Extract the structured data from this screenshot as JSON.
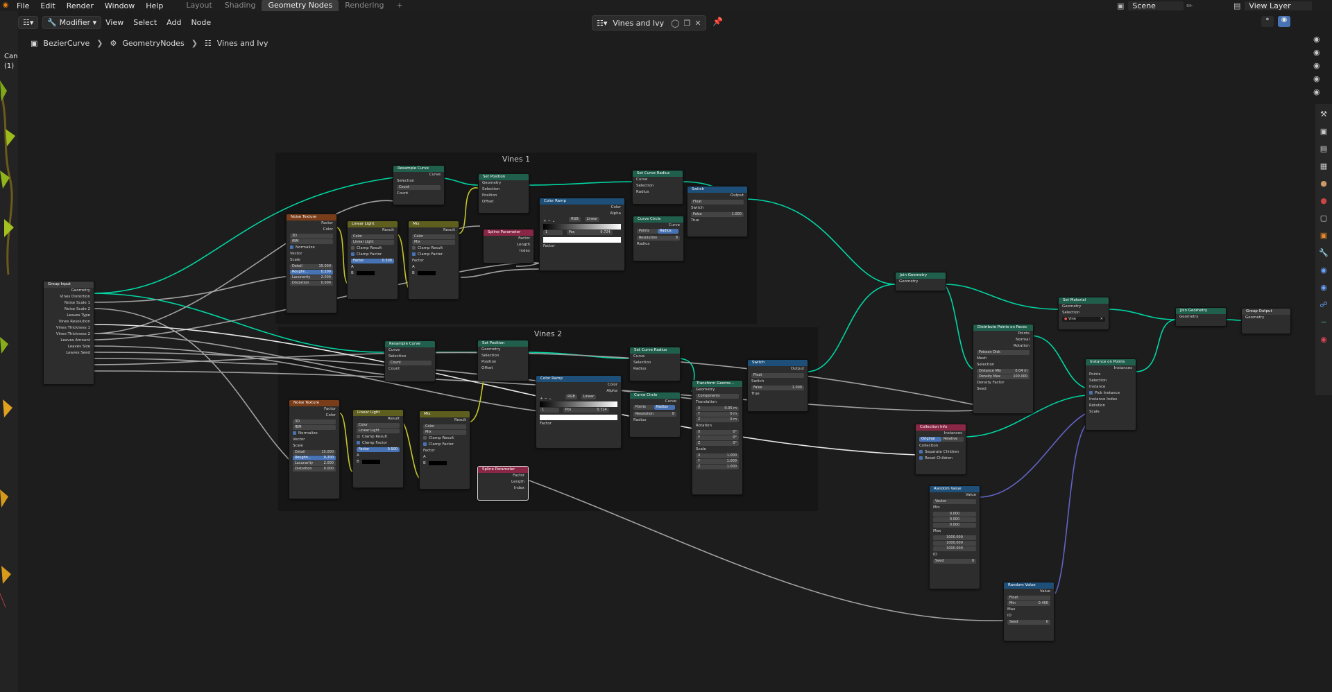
{
  "menubar": {
    "menus": [
      "File",
      "Edit",
      "Render",
      "Window",
      "Help"
    ],
    "workspaces": [
      "Layout",
      "Shading",
      "Geometry Nodes",
      "Rendering"
    ],
    "active_workspace": "Geometry Nodes",
    "add_tab": "+",
    "scene": "Scene",
    "view_layer": "View Layer"
  },
  "editor_header": {
    "editor_type_icon": "node-editor-icon",
    "modifier_menu": "Modifier",
    "menus": [
      "View",
      "Select",
      "Add",
      "Node"
    ],
    "node_tree_name": "Vines and Ivy"
  },
  "breadcrumb": {
    "items": [
      "BezierCurve",
      "GeometryNodes",
      "Vines and Ivy"
    ],
    "icons": [
      "curve-object-icon",
      "modifier-icon",
      "node-tree-icon"
    ]
  },
  "left_panel": {
    "clip_text_1": "Can",
    "clip_text_2": "(1)"
  },
  "frames": [
    {
      "title": "Vines 1"
    },
    {
      "title": "Vines 2"
    }
  ],
  "colors": {
    "geometry_link": "#00d6a3",
    "float_link": "#a1a1a1",
    "vector_link": "#6363c7",
    "color_link": "#c7c729",
    "bool_link": "#cca6d6",
    "header_green": "#1f5f4b",
    "header_orange": "#7a3d1a",
    "header_olive": "#5e5e1f",
    "header_blue": "#1e4f78",
    "header_pink": "#8a2747",
    "header_gray": "#3c3c3c"
  },
  "nodes": {
    "group_input": {
      "title": "Group Input",
      "outputs": [
        "Geometry",
        "Vines Distortion",
        "Noise Scale 1",
        "Noise Scale 2",
        "Leaves Type",
        "Vines Resolution",
        "Vines Thickness 1",
        "Vines Thickness 2",
        "Leaves Amount",
        "Leaves Size",
        "Leaves Seed"
      ]
    },
    "resample1": {
      "title": "Resample Curve",
      "rows": [
        "Curve",
        "Curve",
        "Selection",
        "Count",
        "Count"
      ]
    },
    "setpos1": {
      "title": "Set Position",
      "rows": [
        "Geometry",
        "Geometry",
        "Selection",
        "Position",
        "Offset"
      ]
    },
    "noise1": {
      "title": "Noise Texture",
      "out1": "Factor",
      "out2": "Color",
      "dim": "3D",
      "type": "fBM",
      "normalize": "Normalize",
      "vector": "Vector",
      "scale": "Scale",
      "detail": "Detail",
      "detail_v": "15.000",
      "rough": "Roughn...",
      "rough_v": "0.200",
      "lac": "Lacunarity",
      "lac_v": "2.000",
      "dist": "Distortion",
      "dist_v": "0.000"
    },
    "linlight1": {
      "title": "Linear Light",
      "out": "Result",
      "mode": "Color",
      "blend": "Linear Light",
      "clamp_res": "Clamp Result",
      "clamp_fac": "Clamp Factor",
      "fac": "Factor",
      "fac_v": "0.500",
      "a": "A",
      "b": "B"
    },
    "mix1": {
      "title": "Mix",
      "out": "Result",
      "mode": "Color",
      "blend": "Mix",
      "clamp_res": "Clamp Result",
      "clamp_fac": "Clamp Factor",
      "fac": "Factor",
      "a": "A",
      "b": "B"
    },
    "spline1": {
      "title": "Spline Parameter",
      "rows": [
        "Factor",
        "Length",
        "Index"
      ]
    },
    "ramp1": {
      "title": "Color Ramp",
      "out1": "Color",
      "out2": "Alpha",
      "mode": "RGB",
      "interp": "Linear",
      "idx": "1",
      "pos": "Pos",
      "pos_v": "0.724",
      "fac": "Factor"
    },
    "curverad1": {
      "title": "Set Curve Radius",
      "rows": [
        "Curve",
        "Curve",
        "Selection",
        "Radius"
      ]
    },
    "curvecircle1": {
      "title": "Curve Circle",
      "out": "Curve",
      "mode1": "Points",
      "mode2": "Radius",
      "res": "Resolution",
      "res_v": "8",
      "radius": "Radius"
    },
    "switch1": {
      "title": "Switch",
      "out": "Output",
      "type": "Float",
      "sw": "Switch",
      "false_l": "False",
      "false_v": "1.000",
      "true_l": "True"
    },
    "resample2": {
      "title": "Resample Curve",
      "rows": [
        "Curve",
        "Curve",
        "Selection",
        "Count",
        "Count"
      ]
    },
    "setpos2": {
      "title": "Set Position",
      "rows": [
        "Geometry",
        "Geometry",
        "Selection",
        "Position",
        "Offset"
      ]
    },
    "noise2": {
      "title": "Noise Texture",
      "out1": "Factor",
      "out2": "Color",
      "dim": "3D",
      "type": "fBM",
      "normalize": "Normalize",
      "vector": "Vector",
      "scale": "Scale",
      "detail": "Detail",
      "detail_v": "15.000",
      "rough": "Roughn...",
      "rough_v": "0.200",
      "lac": "Lacunarity",
      "lac_v": "2.000",
      "dist": "Distortion",
      "dist_v": "0.000"
    },
    "linlight2": {
      "title": "Linear Light",
      "out": "Result",
      "mode": "Color",
      "blend": "Linear Light",
      "clamp_res": "Clamp Result",
      "clamp_fac": "Clamp Factor",
      "fac": "Factor",
      "fac_v": "0.500",
      "a": "A",
      "b": "B"
    },
    "mix2": {
      "title": "Mix",
      "out": "Result",
      "mode": "Color",
      "blend": "Mix",
      "clamp_res": "Clamp Result",
      "clamp_fac": "Clamp Factor",
      "fac": "Factor",
      "a": "A",
      "b": "B"
    },
    "spline2": {
      "title": "Spline Parameter",
      "rows": [
        "Factor",
        "Length",
        "Index"
      ]
    },
    "ramp2": {
      "title": "Color Ramp",
      "out1": "Color",
      "out2": "Alpha",
      "mode": "RGB",
      "interp": "Linear",
      "idx": "1",
      "pos": "Pos",
      "pos_v": "0.724",
      "fac": "Factor"
    },
    "curverad2": {
      "title": "Set Curve Radius",
      "rows": [
        "Curve",
        "Curve",
        "Selection",
        "Radius"
      ]
    },
    "curvecircle2": {
      "title": "Curve Circle",
      "out": "Curve",
      "mode1": "Points",
      "mode2": "Radius",
      "res": "Resolution",
      "res_v": "8",
      "radius": "Radius"
    },
    "transform": {
      "title": "Transform Geome...",
      "rows": [
        "Geometry",
        "Components",
        "Translation"
      ],
      "tx": "X",
      "tx_v": "0.05 m",
      "ty": "Y",
      "ty_v": "0 m",
      "tz": "Z",
      "tz_v": "0 m",
      "rot": "Rotation",
      "rx": "X",
      "rx_v": "0°",
      "ry": "Y",
      "ry_v": "0°",
      "rz": "Z",
      "rz_v": "0°",
      "scl": "Scale",
      "sx": "X",
      "sx_v": "1.000",
      "sy": "Y",
      "sy_v": "1.000",
      "sz": "Z",
      "sz_v": "1.000"
    },
    "switch2": {
      "title": "Switch",
      "out": "Output",
      "type": "Float",
      "sw": "Switch",
      "false_l": "False",
      "false_v": "1.000",
      "true_l": "True"
    },
    "join1": {
      "title": "Join Geometry",
      "rows": [
        "Geometry"
      ]
    },
    "setmat": {
      "title": "Set Material",
      "rows": [
        "Geometry",
        "Geometry",
        "Selection"
      ],
      "material": "Vine"
    },
    "join2": {
      "title": "Join Geometry",
      "rows": [
        "Geometry"
      ]
    },
    "groupout": {
      "title": "Group Output",
      "rows": [
        "Geometry"
      ]
    },
    "distribute": {
      "title": "Distribute Points on Faces",
      "outs": [
        "Points",
        "Normal",
        "Rotation"
      ],
      "mode": "Poisson Disk",
      "mesh": "Mesh",
      "sel": "Selection",
      "dmin": "Distance Min",
      "dmin_v": "0.04 m",
      "dmax": "Density Max",
      "dmax_v": "100.000",
      "df": "Density Factor",
      "seed": "Seed"
    },
    "instance": {
      "title": "Instance on Points",
      "out": "Instances",
      "rows": [
        "Points",
        "Selection",
        "Instance",
        "Pick Instance",
        "Instance Index",
        "Rotation",
        "Scale"
      ]
    },
    "collinfo": {
      "title": "Collection Info",
      "out": "Instances",
      "mode1": "Original",
      "mode2": "Relative",
      "coll": "Collection",
      "sep": "Separate Children",
      "reset": "Reset Children"
    },
    "random1": {
      "title": "Random Value",
      "out": "Value",
      "type": "Vector",
      "min": "Min",
      "min_vals": [
        "0.000",
        "0.000",
        "0.000"
      ],
      "max": "Max",
      "max_vals": [
        "1000.000",
        "1000.000",
        "1000.000"
      ],
      "id": "ID",
      "seed": "Seed",
      "seed_v": "0"
    },
    "random2": {
      "title": "Random Value",
      "out": "Value",
      "type": "Float",
      "min": "Min",
      "min_v": "0.400",
      "max": "Max",
      "id": "ID",
      "seed": "Seed",
      "seed_v": "0"
    }
  }
}
